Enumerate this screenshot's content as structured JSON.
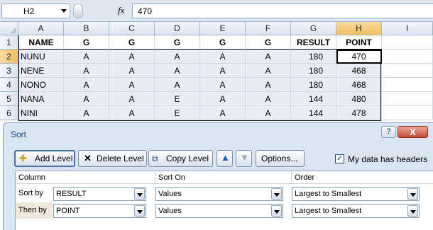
{
  "formula_bar": {
    "name_box": "H2",
    "fx_label": "fx",
    "value": "470"
  },
  "sheet": {
    "columns": [
      "A",
      "B",
      "C",
      "D",
      "E",
      "F",
      "G",
      "H",
      "I"
    ],
    "rows": [
      "1",
      "2",
      "3",
      "4",
      "5",
      "6"
    ],
    "data": [
      [
        "NAME",
        "G",
        "G",
        "G",
        "G",
        "G",
        "RESULT",
        "POINT"
      ],
      [
        "NUNU",
        "A",
        "A",
        "A",
        "A",
        "A",
        "180",
        "470"
      ],
      [
        "NENE",
        "A",
        "A",
        "A",
        "A",
        "A",
        "180",
        "468"
      ],
      [
        "NONO",
        "A",
        "A",
        "A",
        "A",
        "A",
        "180",
        "468"
      ],
      [
        "NANA",
        "A",
        "A",
        "E",
        "A",
        "A",
        "144",
        "480"
      ],
      [
        "NINI",
        "A",
        "A",
        "E",
        "A",
        "A",
        "144",
        "478"
      ]
    ]
  },
  "sort_dialog": {
    "title": "Sort",
    "help_label": "?",
    "close_label": "X",
    "toolbar": {
      "add_level": "Add Level",
      "delete_level": "Delete Level",
      "copy_level": "Copy Level",
      "options": "Options..."
    },
    "my_data_has_headers": {
      "label": "My data has headers",
      "checked": true,
      "check_mark": "✓"
    },
    "headers": {
      "column": "Column",
      "sort_on": "Sort On",
      "order": "Order"
    },
    "levels": [
      {
        "label": "Sort by",
        "column": "RESULT",
        "sort_on": "Values",
        "order": "Largest to Smallest"
      },
      {
        "label": "Then by",
        "column": "POINT",
        "sort_on": "Values",
        "order": "Largest to Smallest"
      }
    ]
  },
  "colors": {
    "selected_header": "#f1c15f",
    "dialog_background": "#dbe5f2",
    "close_button": "#c44a33"
  }
}
